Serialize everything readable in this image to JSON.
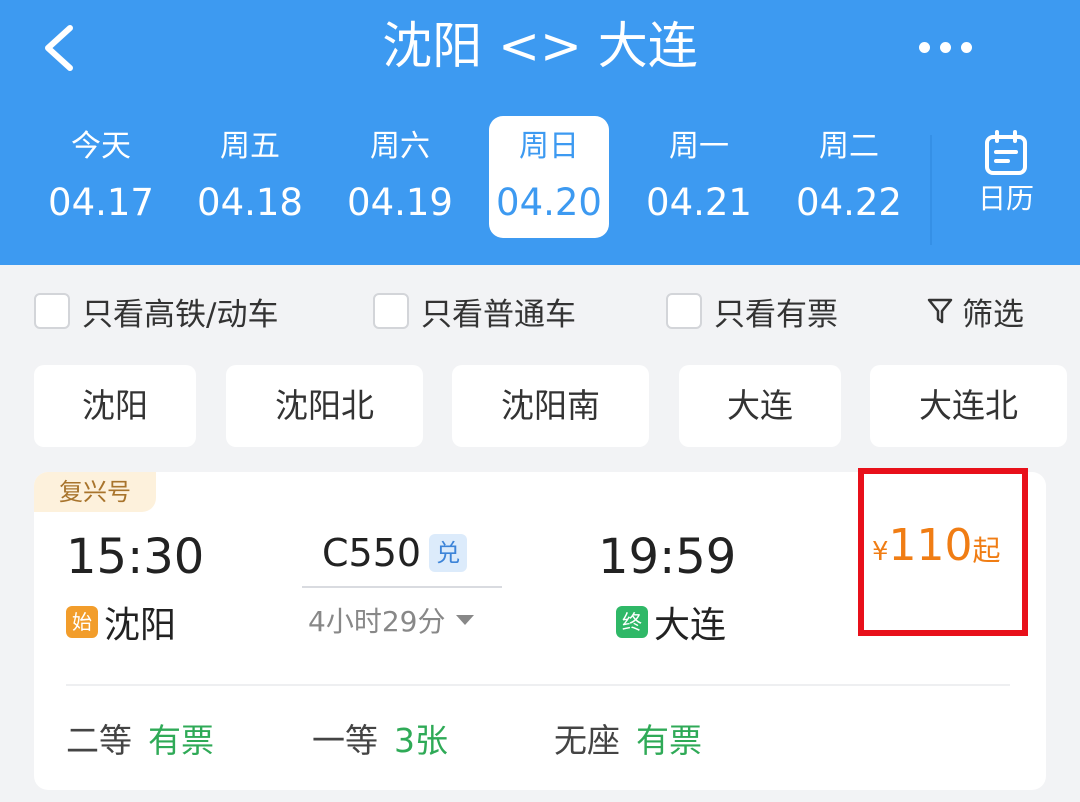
{
  "header": {
    "title": "沈阳 <> 大连",
    "background_color": "#3d9af1",
    "back_icon": "chevron-left-icon",
    "more_icon": "more-horizontal-icon"
  },
  "dates": [
    {
      "day": "今天",
      "date": "04.17",
      "selected": false
    },
    {
      "day": "周五",
      "date": "04.18",
      "selected": false
    },
    {
      "day": "周六",
      "date": "04.19",
      "selected": false
    },
    {
      "day": "周日",
      "date": "04.20",
      "selected": true
    },
    {
      "day": "周一",
      "date": "04.21",
      "selected": false
    },
    {
      "day": "周二",
      "date": "04.22",
      "selected": false
    }
  ],
  "calendar": {
    "label": "日历",
    "icon": "calendar-icon"
  },
  "filters": {
    "high_speed": "只看高铁/动车",
    "normal": "只看普通车",
    "available": "只看有票",
    "filter_label": "筛选",
    "filter_icon": "funnel-icon"
  },
  "stations": [
    "沈阳",
    "沈阳北",
    "沈阳南",
    "大连",
    "大连北"
  ],
  "train": {
    "brand": "复兴号",
    "depart_time": "15:30",
    "depart_badge": "始",
    "depart_station": "沈阳",
    "train_no": "C550",
    "redeem_badge": "兑",
    "duration": "4小时29分",
    "arrive_time": "19:59",
    "arrive_badge": "终",
    "arrive_station": "大连",
    "price_currency": "¥",
    "price_amount": "110",
    "price_suffix": "起",
    "price_color": "#f07d14",
    "seats": [
      {
        "class": "二等",
        "availability": "有票"
      },
      {
        "class": "一等",
        "availability": "3张"
      },
      {
        "class": "无座",
        "availability": "有票"
      }
    ],
    "availability_color": "#2faa57",
    "highlight_color": "#e8101a"
  }
}
